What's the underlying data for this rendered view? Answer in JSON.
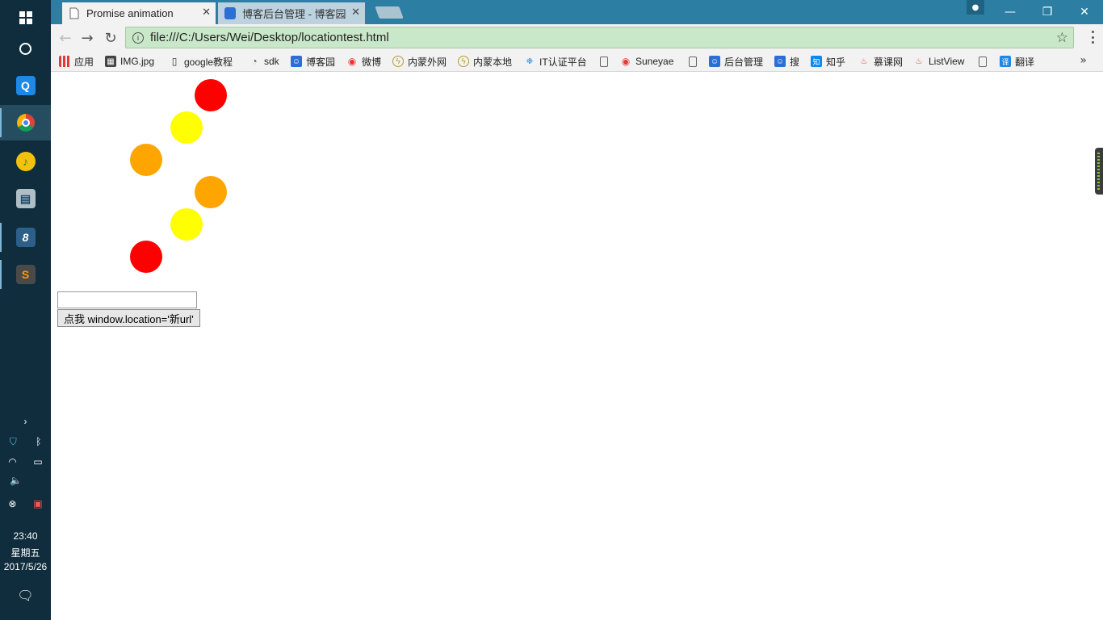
{
  "taskbar": {
    "clock_time": "23:40",
    "clock_day": "星期五",
    "clock_date": "2017/5/26"
  },
  "browser": {
    "tabs": [
      {
        "label": "Promise animation",
        "active": true
      },
      {
        "label": "博客后台管理 - 博客园",
        "active": false
      }
    ],
    "url": "file:///C:/Users/Wei/Desktop/locationtest.html",
    "bookmarks": [
      {
        "label": "应用",
        "icon": "apps-grid-icon"
      },
      {
        "label": "IMG.jpg",
        "icon": "image-icon"
      },
      {
        "label": "google教程",
        "icon": "book-icon"
      },
      {
        "label": "sdk",
        "icon": "sdk-icon"
      },
      {
        "label": "博客园",
        "icon": "cnblogs-icon"
      },
      {
        "label": "微博",
        "icon": "weibo-icon"
      },
      {
        "label": "内蒙外网",
        "icon": "lightning-icon"
      },
      {
        "label": "内蒙本地",
        "icon": "lightning-icon"
      },
      {
        "label": "IT认证平台",
        "icon": "it-icon"
      },
      {
        "label": "",
        "icon": "page-icon"
      },
      {
        "label": "Suneyae",
        "icon": "weibo-icon"
      },
      {
        "label": "",
        "icon": "page-icon"
      },
      {
        "label": "后台管理",
        "icon": "cnblogs-icon"
      },
      {
        "label": "搜",
        "icon": "cnblogs-icon"
      },
      {
        "label": "知乎",
        "icon": "zhihu-icon"
      },
      {
        "label": "慕课网",
        "icon": "flame-icon"
      },
      {
        "label": "ListView",
        "icon": "flame-icon"
      },
      {
        "label": "",
        "icon": "page-icon"
      },
      {
        "label": "翻译",
        "icon": "translate-icon"
      }
    ]
  },
  "page": {
    "balls": [
      {
        "color": "#ff0000"
      },
      {
        "color": "#ffff00"
      },
      {
        "color": "#ffa500"
      },
      {
        "color": "#ffa500"
      },
      {
        "color": "#ffff00"
      },
      {
        "color": "#ff0000"
      }
    ],
    "input_value": "",
    "button_label": "点我 window.location='新url'"
  }
}
